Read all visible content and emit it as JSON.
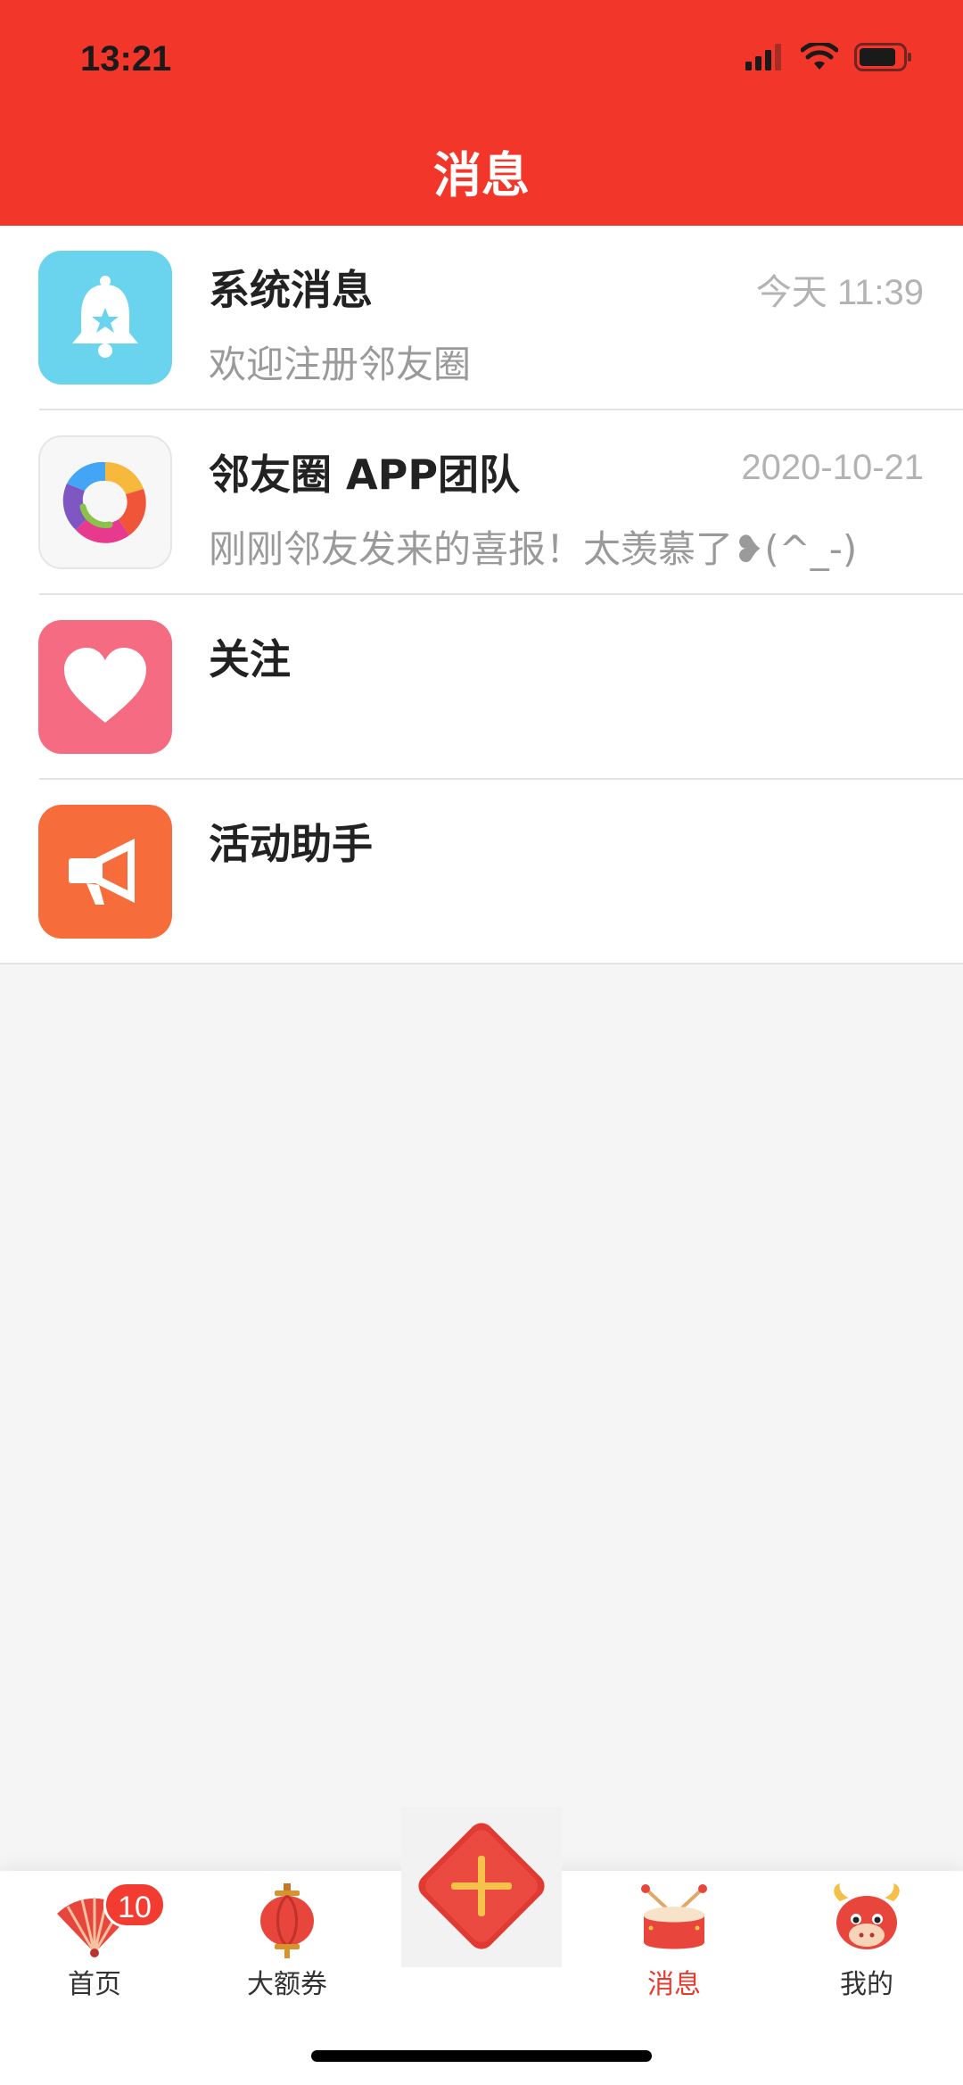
{
  "status_bar": {
    "time": "13:21"
  },
  "header": {
    "title": "消息"
  },
  "messages": [
    {
      "title": "系统消息",
      "time": "今天 11:39",
      "preview": "欢迎注册邻友圈",
      "icon": "bell-icon",
      "icon_color": "#6ad3ee"
    },
    {
      "title": "邻友圈 APP团队",
      "time": "2020-10-21",
      "preview": "刚刚邻友发来的喜报！太羡慕了❥(^_-)",
      "icon": "app-logo-icon",
      "icon_color": "#f7f7f7"
    },
    {
      "title": "关注",
      "time": "",
      "preview": "",
      "icon": "heart-icon",
      "icon_color": "#f56b82"
    },
    {
      "title": "活动助手",
      "time": "",
      "preview": "",
      "icon": "megaphone-icon",
      "icon_color": "#f66c3a"
    }
  ],
  "tabbar": {
    "home_label": "首页",
    "home_badge": "10",
    "coupon_label": "大额券",
    "messages_label": "消息",
    "mine_label": "我的"
  },
  "colors": {
    "brand_red": "#f2362a",
    "active_tab": "#e83a2e"
  }
}
